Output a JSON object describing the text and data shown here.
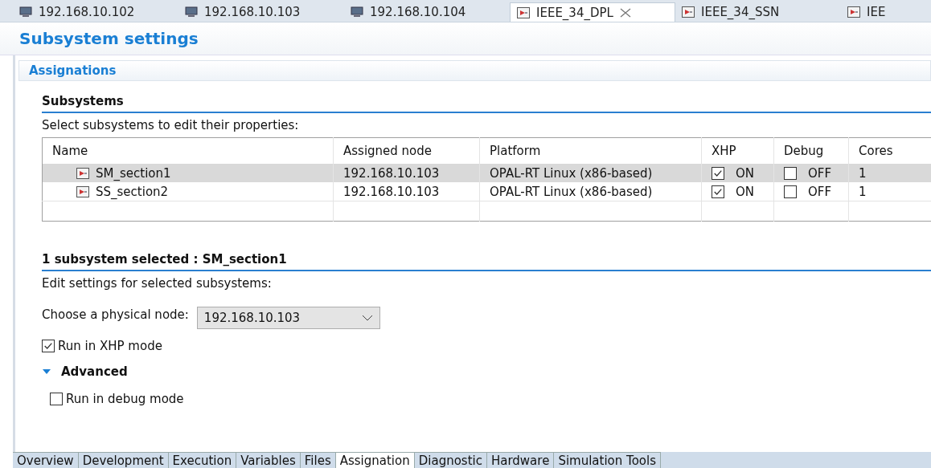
{
  "editor_tabs": [
    {
      "label": "192.168.10.102",
      "kind": "node",
      "selected": false
    },
    {
      "label": "192.168.10.103",
      "kind": "node",
      "selected": false
    },
    {
      "label": "192.168.10.104",
      "kind": "node",
      "selected": false
    },
    {
      "label": "IEEE_34_DPL",
      "kind": "model",
      "selected": true
    },
    {
      "label": "IEEE_34_SSN",
      "kind": "model",
      "selected": false
    },
    {
      "label": "IEE",
      "kind": "model",
      "selected": false
    }
  ],
  "page_title": "Subsystem settings",
  "section_tab": "Assignations",
  "subsystems": {
    "title": "Subsystems",
    "description": "Select subsystems to edit their properties:",
    "columns": [
      "Name",
      "Assigned node",
      "Platform",
      "XHP",
      "Debug",
      "Cores"
    ],
    "rows": [
      {
        "name": "SM_section1",
        "node": "192.168.10.103",
        "platform": "OPAL-RT Linux (x86-based)",
        "xhp": {
          "checked": true,
          "label": "ON"
        },
        "debug": {
          "checked": false,
          "label": "OFF"
        },
        "cores": "1",
        "selected": true
      },
      {
        "name": "SS_section2",
        "node": "192.168.10.103",
        "platform": "OPAL-RT Linux (x86-based)",
        "xhp": {
          "checked": true,
          "label": "ON"
        },
        "debug": {
          "checked": false,
          "label": "OFF"
        },
        "cores": "1",
        "selected": false
      }
    ]
  },
  "selection": {
    "title": "1 subsystem selected : SM_section1",
    "description": "Edit settings for selected subsystems:",
    "node_label": "Choose a physical node:",
    "node_value": "192.168.10.103",
    "xhp_mode": {
      "label": "Run in XHP mode",
      "checked": true
    },
    "advanced": {
      "label": "Advanced",
      "expanded": true
    },
    "debug_mode": {
      "label": "Run in debug mode",
      "checked": false
    }
  },
  "bottom_tabs": [
    {
      "label": "Overview",
      "selected": false
    },
    {
      "label": "Development",
      "selected": false
    },
    {
      "label": "Execution",
      "selected": false
    },
    {
      "label": "Variables",
      "selected": false
    },
    {
      "label": "Files",
      "selected": false
    },
    {
      "label": "Assignation",
      "selected": true
    },
    {
      "label": "Diagnostic",
      "selected": false
    },
    {
      "label": "Hardware",
      "selected": false
    },
    {
      "label": "Simulation Tools",
      "selected": false
    }
  ]
}
